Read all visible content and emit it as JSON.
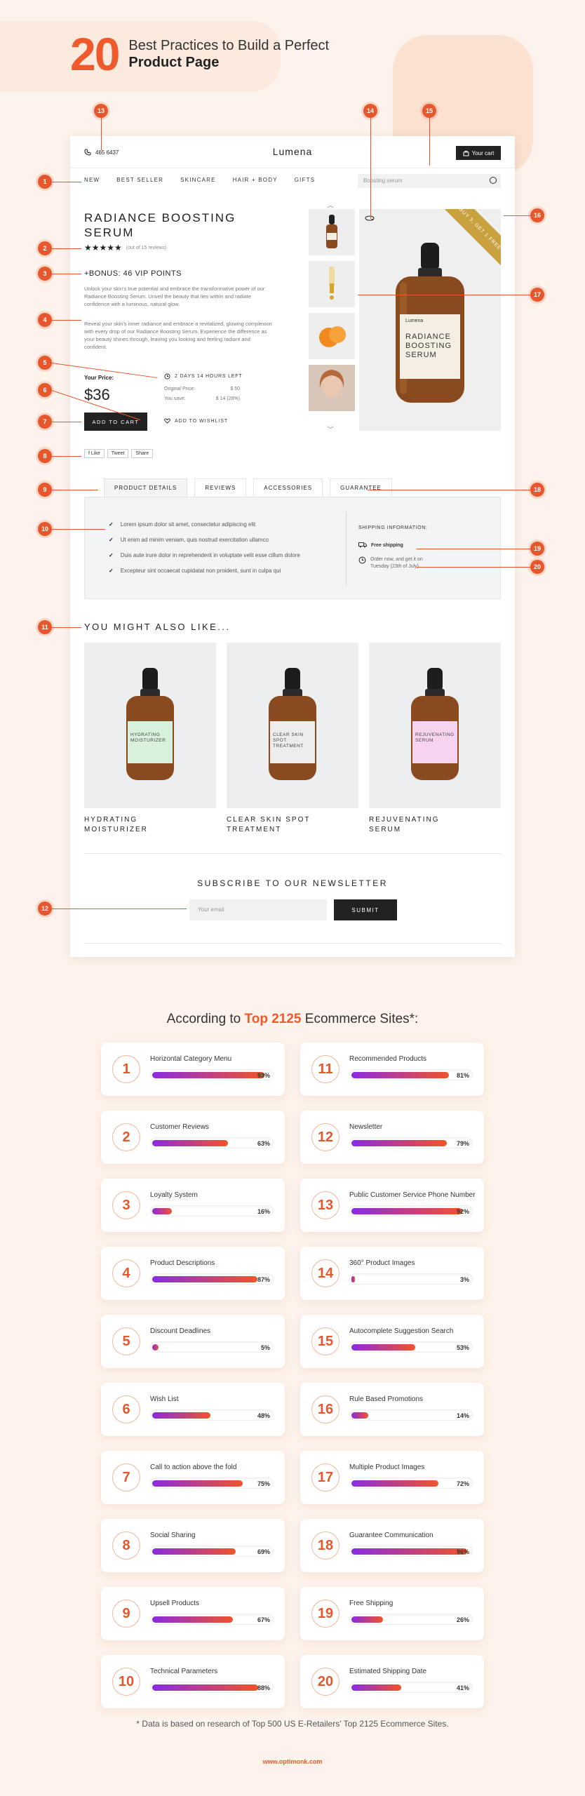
{
  "header": {
    "number": "20",
    "line1": "Best Practices to Build a Perfect",
    "line2": "Product Page"
  },
  "store": {
    "phone": "465 6437",
    "logo": "Lumena",
    "cart_label": "Your cart",
    "nav": [
      "NEW",
      "BEST SELLER",
      "SKINCARE",
      "HAIR + BODY",
      "GIFTS"
    ],
    "search_placeholder": "Boosting serum",
    "product_title": "RADIANCE BOOSTING SERUM",
    "stars": "★★★★★",
    "reviews": "(out of 15 reviews)",
    "bonus": "+BONUS: 46 VIP POINTS",
    "desc1": "Unlock your skin's true potential and embrace the transformative power of our Radiance Boosting Serum. Unveil the beauty that lies within and radiate confidence with a luminous, natural glow.",
    "desc2": "Reveal your skin's inner radiance and embrace a revitalized, glowing complexion with every drop of our Radiance Boosting Serum. Experience the difference as your beauty shines through, leaving you looking and feeling radiant and confident.",
    "your_price_label": "Your Price:",
    "price": "$36",
    "timer": "2 DAYS 14 HOURS LEFT",
    "original_label": "Original Price:",
    "original_value": "$ 50",
    "save_label": "You save:",
    "save_value": "$ 14 (28%)",
    "add_to_cart": "ADD TO CART",
    "wishlist": "ADD TO WISHLIST",
    "share": [
      "f Like",
      "Tweet",
      "Share"
    ],
    "ribbon": "BUY 3, GET 1 FREE",
    "bottle_brand": "Lumena",
    "bottle_text": "RADIANCE BOOSTING SERUM",
    "tabs": [
      "PRODUCT DETAILS",
      "REVIEWS",
      "ACCESSORIES",
      "GUARANTEE"
    ],
    "bullets": [
      "Lorem ipsum dolor sit amet, consectetur adipiscing elit",
      "Ut enim ad minim veniam, quis nostrud exercitation ullamco",
      "Duis aute irure dolor in reprehenderit in voluptate velit esse cillum dolore",
      "Excepteur sint occaecat cupidatat non proident, sunt in culpa qui"
    ],
    "shipping_title": "SHIPPING INFORMATION:",
    "free_shipping": "Free shipping",
    "order_now": "Order now, and get it on",
    "order_date": "Tuesday (23th of July)",
    "also_like": "YOU MIGHT ALSO LIKE...",
    "related": [
      {
        "label": "HYDRATING MOISTURIZER",
        "bottle": "HYDRATING MOISTURIZER",
        "color": "#d7f1dd"
      },
      {
        "label": "CLEAR SKIN SPOT TREATMENT",
        "bottle": "CLEAR SKIN SPOT TREATMENT",
        "color": "#ededed"
      },
      {
        "label": "REJUVENATING SERUM",
        "bottle": "REJUVENATING SERUM",
        "color": "#f6d4ef"
      }
    ],
    "newsletter": "SUBSCRIBE TO OUR NEWSLETTER",
    "email_placeholder": "Your email",
    "submit": "SUBMIT"
  },
  "callouts": [
    "1",
    "2",
    "3",
    "4",
    "5",
    "6",
    "7",
    "8",
    "9",
    "10",
    "11",
    "12",
    "13",
    "14",
    "15",
    "16",
    "17",
    "18",
    "19",
    "20"
  ],
  "stats_title": {
    "pre": "According to ",
    "hl": "Top 2125",
    "post": " Ecommerce Sites*:"
  },
  "stats": [
    {
      "n": "1",
      "label": "Horizontal Category Menu",
      "pct": 93
    },
    {
      "n": "11",
      "label": "Recommended Products",
      "pct": 81
    },
    {
      "n": "2",
      "label": "Customer Reviews",
      "pct": 63
    },
    {
      "n": "12",
      "label": "Newsletter",
      "pct": 79
    },
    {
      "n": "3",
      "label": "Loyalty System",
      "pct": 16
    },
    {
      "n": "13",
      "label": "Public Customer Service Phone Number",
      "pct": 92
    },
    {
      "n": "4",
      "label": "Product Descriptions",
      "pct": 87
    },
    {
      "n": "14",
      "label": "360° Product Images",
      "pct": 3
    },
    {
      "n": "5",
      "label": "Discount Deadlines",
      "pct": 5
    },
    {
      "n": "15",
      "label": "Autocomplete Suggestion Search",
      "pct": 53
    },
    {
      "n": "6",
      "label": "Wish List",
      "pct": 48
    },
    {
      "n": "16",
      "label": "Rule Based Promotions",
      "pct": 14
    },
    {
      "n": "7",
      "label": "Call to action above the fold",
      "pct": 75
    },
    {
      "n": "17",
      "label": "Multiple Product Images",
      "pct": 72
    },
    {
      "n": "8",
      "label": "Social Sharing",
      "pct": 69
    },
    {
      "n": "18",
      "label": "Guarantee Communication",
      "pct": 96
    },
    {
      "n": "9",
      "label": "Upsell Products",
      "pct": 67
    },
    {
      "n": "19",
      "label": "Free Shipping",
      "pct": 26
    },
    {
      "n": "10",
      "label": "Technical Parameters",
      "pct": 88
    },
    {
      "n": "20",
      "label": "Estimated Shipping Date",
      "pct": 41
    }
  ],
  "footnote": "* Data is based on research of Top 500 US E-Retailers' Top 2125 Ecommerce Sites.",
  "site": "www.optimonk.com",
  "colors": {
    "accent": "#ee5a2b",
    "bg": "#fdf3ec",
    "bar_start": "#8a2be2",
    "bar_end": "#f0542a"
  }
}
